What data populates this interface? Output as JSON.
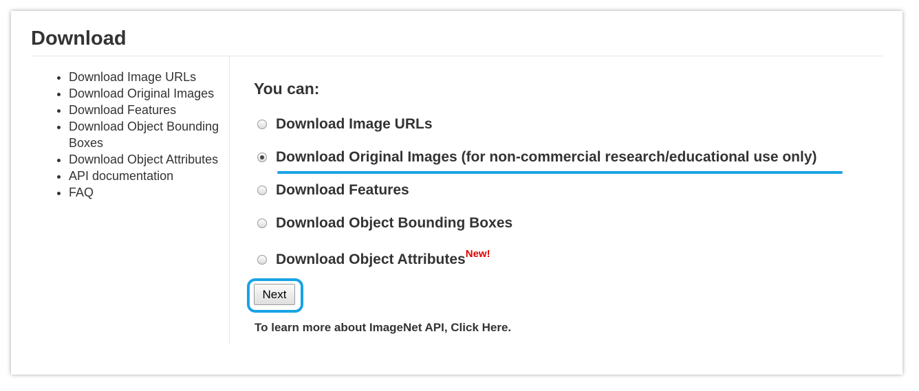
{
  "header": {
    "title": "Download"
  },
  "sidebar": {
    "items": [
      {
        "label": "Download Image URLs"
      },
      {
        "label": "Download Original Images"
      },
      {
        "label": "Download Features"
      },
      {
        "label": "Download Object Bounding Boxes"
      },
      {
        "label": "Download Object Attributes"
      },
      {
        "label": "API documentation"
      },
      {
        "label": "FAQ"
      }
    ]
  },
  "main": {
    "heading": "You can:",
    "options": [
      {
        "label": "Download Image URLs",
        "checked": false
      },
      {
        "label": "Download Original Images (for non-commercial research/educational use only)",
        "checked": true
      },
      {
        "label": "Download Features",
        "checked": false
      },
      {
        "label": "Download Object Bounding Boxes",
        "checked": false
      },
      {
        "label": "Download Object Attributes",
        "checked": false,
        "badge": "New!"
      }
    ],
    "next_label": "Next",
    "api_link": "To learn more about ImageNet API, Click Here."
  },
  "colors": {
    "highlight": "#1aa3e4",
    "badge": "#e30000",
    "text": "#333333"
  }
}
